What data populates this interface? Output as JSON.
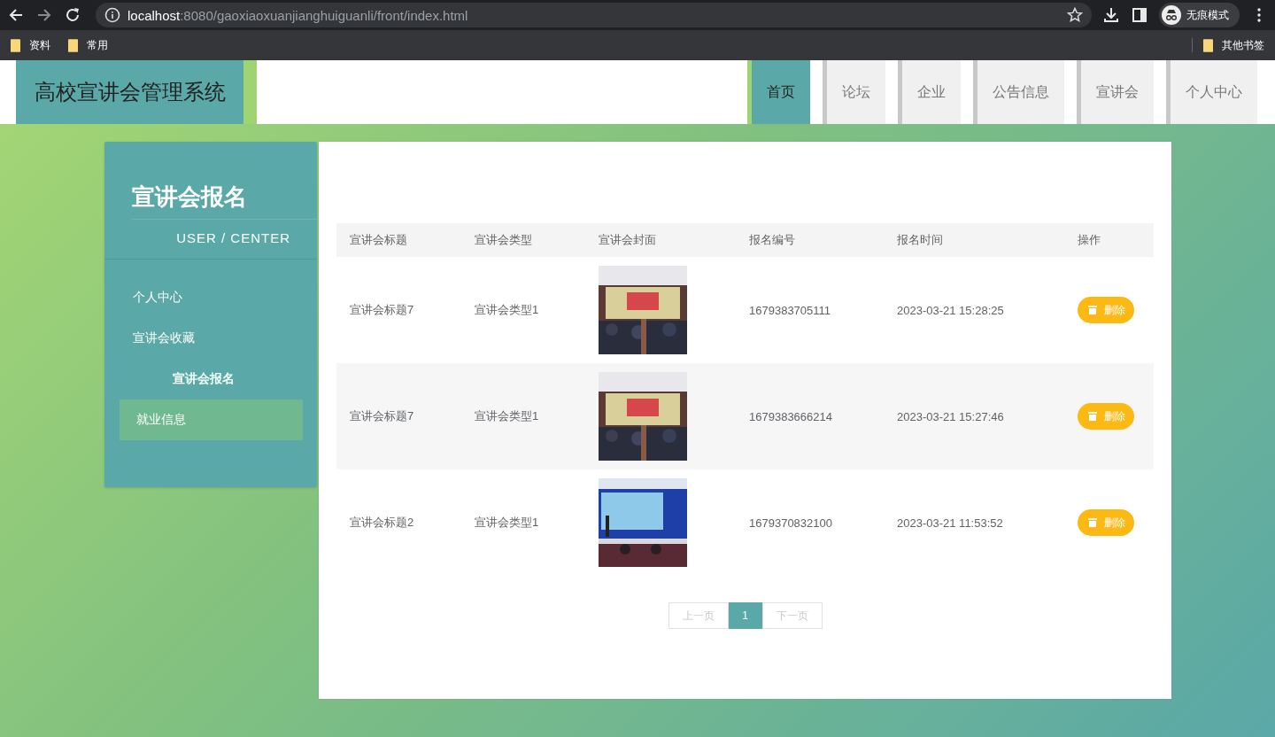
{
  "browser": {
    "url": "**localhost**:8080/gaoxiaoxuanjianghuiguanli/front/index.html",
    "profile": "无痕模式",
    "bookmarks": [
      {
        "label": "资料"
      },
      {
        "label": "常用"
      }
    ],
    "other_bookmarks": "其他书签"
  },
  "site": {
    "title": "高校宣讲会管理系统"
  },
  "nav": [
    {
      "label": "首页",
      "selected": true
    },
    {
      "label": "论坛",
      "selected": false
    },
    {
      "label": "企业",
      "selected": false
    },
    {
      "label": "公告信息",
      "selected": false
    },
    {
      "label": "宣讲会",
      "selected": false
    },
    {
      "label": "个人中心",
      "selected": false
    }
  ],
  "sidebar": {
    "title": "宣讲会报名",
    "subtitle": "USER / CENTER",
    "items": [
      {
        "label": "个人中心",
        "active": false,
        "selected": false
      },
      {
        "label": "宣讲会收藏",
        "active": false,
        "selected": false
      },
      {
        "label": "宣讲会报名",
        "active": true,
        "selected": false
      },
      {
        "label": "就业信息",
        "active": false,
        "selected": true
      }
    ]
  },
  "table": {
    "columns": [
      "宣讲会标题",
      "宣讲会类型",
      "宣讲会封面",
      "报名编号",
      "报名时间",
      "操作"
    ],
    "rows": [
      {
        "title": "宣讲会标题7",
        "type": "宣讲会类型1",
        "number": "1679383705111",
        "time": "2023-03-21 15:28:25",
        "action": "删除"
      },
      {
        "title": "宣讲会标题7",
        "type": "宣讲会类型1",
        "number": "1679383666214",
        "time": "2023-03-21 15:27:46",
        "action": "删除"
      },
      {
        "title": "宣讲会标题2",
        "type": "宣讲会类型1",
        "number": "1679370832100",
        "time": "2023-03-21 11:53:52",
        "action": "删除"
      }
    ]
  },
  "pagination": [
    {
      "label": "上一页",
      "kind": "prev",
      "selected": false,
      "disabled": true
    },
    {
      "label": "1",
      "kind": "page",
      "selected": true,
      "disabled": false
    },
    {
      "label": "下一页",
      "kind": "next",
      "selected": false,
      "disabled": true
    }
  ]
}
